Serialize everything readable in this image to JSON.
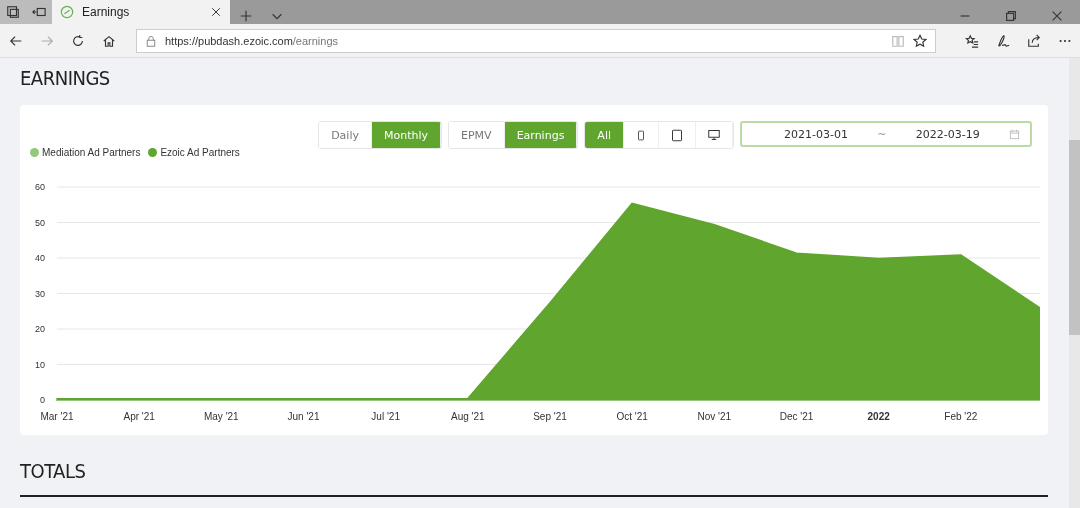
{
  "browser": {
    "tabs": [
      {
        "title": "Earnings",
        "selected": true
      }
    ],
    "url_host": "https://pubdash.ezoic.com",
    "url_path": "/earnings"
  },
  "page": {
    "title": "EARNINGS",
    "totals_title": "TOTALS"
  },
  "controls": {
    "period": [
      {
        "label": "Daily",
        "selected": false
      },
      {
        "label": "Monthly",
        "selected": true
      }
    ],
    "metric": [
      {
        "label": "EPMV",
        "selected": false
      },
      {
        "label": "Earnings",
        "selected": true
      }
    ],
    "device": [
      {
        "kind": "text",
        "label": "All",
        "selected": true
      },
      {
        "kind": "phone",
        "selected": false
      },
      {
        "kind": "tablet",
        "selected": false
      },
      {
        "kind": "desktop",
        "selected": false
      }
    ],
    "date_from": "2021-03-01",
    "date_sep": "~",
    "date_to": "2022-03-19"
  },
  "chart_data": {
    "type": "area",
    "categories": [
      "Mar '21",
      "Apr '21",
      "May '21",
      "Jun '21",
      "Jul '21",
      "Aug '21",
      "Sep '21",
      "Oct '21",
      "Nov '21",
      "Dec '21",
      "2022",
      "Feb '22",
      null
    ],
    "grid": true,
    "yticks": [
      0,
      10,
      20,
      30,
      40,
      50,
      60
    ],
    "ylim": [
      0,
      60
    ],
    "stacked": true,
    "series": [
      {
        "name": "Mediation Ad Partners",
        "color": "#93c97a",
        "values": [
          0.3,
          0.3,
          0.3,
          0.3,
          0.3,
          0.3,
          0.3,
          0.3,
          0.3,
          0.3,
          0.3,
          0.3,
          0.3
        ]
      },
      {
        "name": "Ezoic Ad Partners",
        "color": "#5fa52e",
        "values": [
          0,
          0,
          0,
          0,
          0,
          0,
          27,
          55,
          49,
          41,
          39.5,
          40.5,
          25
        ]
      }
    ]
  }
}
